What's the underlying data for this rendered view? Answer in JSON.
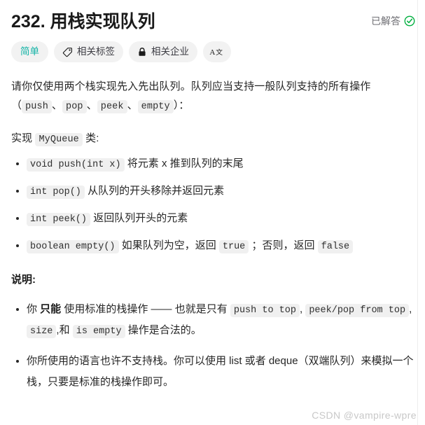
{
  "header": {
    "title": "232. 用栈实现队列",
    "solved_label": "已解答",
    "solved_icon": "check-circle-icon",
    "accent_green": "#00af3f",
    "muted_text": "#6e6e73"
  },
  "badges": [
    {
      "label": "简单",
      "icon": null,
      "color": "#11b2a5",
      "name": "difficulty-badge"
    },
    {
      "label": "相关标签",
      "icon": "tag-icon",
      "name": "related-tags-button"
    },
    {
      "label": "相关企业",
      "icon": "lock-icon",
      "name": "related-companies-button"
    },
    {
      "label": "",
      "icon": "translate-icon",
      "name": "translate-button"
    }
  ],
  "description": {
    "intro_1": "请你仅使用两个栈实现先入先出队列。队列应当支持一般队列支持的所有操作（",
    "code_push": "push",
    "sep_1": "、",
    "code_pop": "pop",
    "sep_2": "、",
    "code_peek": "peek",
    "sep_3": "、",
    "code_empty": "empty",
    "intro_2": "）：",
    "impl_prefix": "实现 ",
    "impl_code": "MyQueue",
    "impl_suffix": " 类:"
  },
  "methods": [
    {
      "code": "void push(int x)",
      "text": "将元素 x 推到队列的末尾"
    },
    {
      "code": "int pop()",
      "text": "从队列的开头移除并返回元素"
    },
    {
      "code": "int peek()",
      "text": "返回队列开头的元素"
    },
    {
      "code": "boolean empty()",
      "text_before": "如果队列为空，返回 ",
      "code_true": "true",
      "text_mid": " ；否则，返回 ",
      "code_false": "false"
    }
  ],
  "notes": {
    "title": "说明:",
    "item1": {
      "part1": "你 ",
      "emphasis": "只能",
      "part2": " 使用标准的栈操作 —— 也就是只有 ",
      "code1": "push to top",
      "comma1": ", ",
      "code2": "peek/pop from top",
      "comma2": ", ",
      "code3": "size",
      "comma3": ",",
      "part3": "和 ",
      "code4": "is empty",
      "part4": " 操作是合法的。"
    },
    "item2": "你所使用的语言也许不支持栈。你可以使用 list 或者 deque（双端队列）来模拟一个栈，只要是标准的栈操作即可。"
  },
  "watermark": "CSDN @vampire-wpre"
}
